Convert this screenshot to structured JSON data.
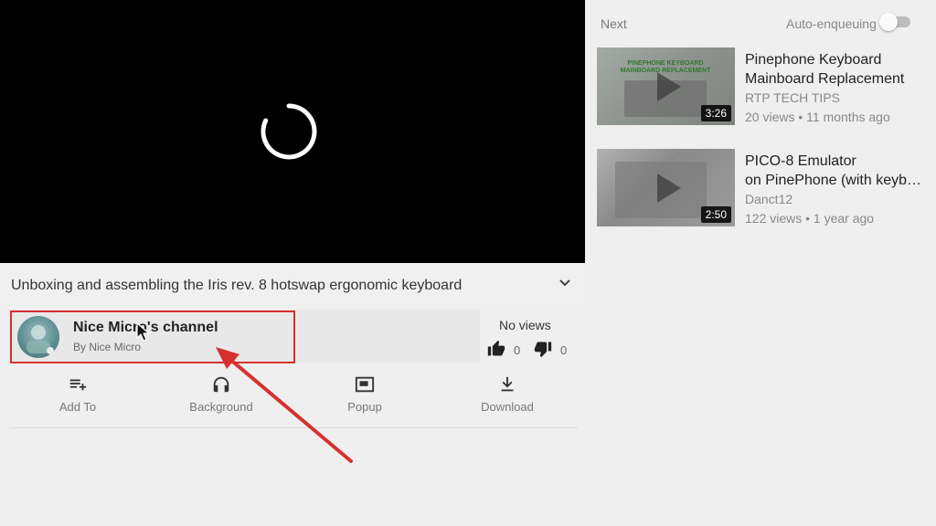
{
  "video": {
    "title": "Unboxing and assembling the Iris rev. 8 hotswap ergonomic keyboard"
  },
  "channel": {
    "name": "Nice Micro's channel",
    "by": "By Nice Micro"
  },
  "stats": {
    "views": "No views",
    "likes": "0",
    "dislikes": "0"
  },
  "actions": [
    {
      "label": "Add To",
      "icon": "playlist-add-icon"
    },
    {
      "label": "Background",
      "icon": "headphones-icon"
    },
    {
      "label": "Popup",
      "icon": "picture-in-picture-icon"
    },
    {
      "label": "Download",
      "icon": "download-icon"
    }
  ],
  "sidebar": {
    "next_label": "Next",
    "auto_enqueue_label": "Auto-enqueuing",
    "auto_enqueue_on": false,
    "items": [
      {
        "title_line1": "Pinephone Keyboard",
        "title_line2": "Mainboard Replacement",
        "thumb_caption": "Pinephone Keyboard Mainboard Replacement",
        "channel": "RTP TECH TIPS",
        "meta": "20 views • 11 months ago",
        "duration": "3:26"
      },
      {
        "title_line1": "PICO-8 Emulator",
        "title_line2": "on PinePhone (with keyboard)",
        "channel": "Danct12",
        "meta": "122 views • 1 year ago",
        "duration": "2:50"
      }
    ]
  },
  "colors": {
    "annotation_red": "#d6312f",
    "player_bg": "#000000",
    "page_bg": "#efefef"
  }
}
